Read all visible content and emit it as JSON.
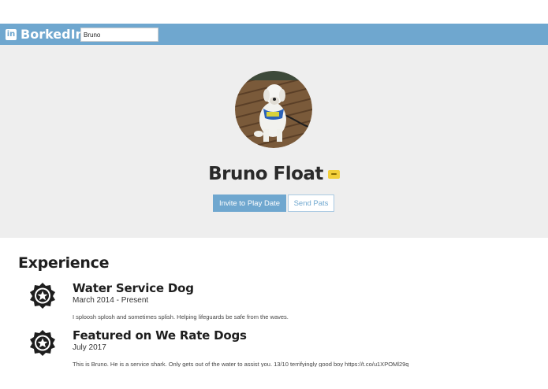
{
  "navbar": {
    "logo_glyph": "in",
    "logo_text": "BorkedIn",
    "search_value": "Bruno",
    "color": "#6fa7cf"
  },
  "profile": {
    "name": "Bruno Float",
    "badge_icon": "dog-badge-icon",
    "primary_button": "Invite to Play Date",
    "secondary_button": "Send Pats",
    "avatar_icon": "dog-photo"
  },
  "experience": {
    "title": "Experience",
    "items": [
      {
        "title": "Water Service Dog",
        "date": "March 2014 - Present",
        "description": "I sploosh splosh and sometimes splish. Helping lifeguards be safe from the waves.",
        "icon": "badge-star-icon"
      },
      {
        "title": "Featured on We Rate Dogs",
        "date": "July 2017",
        "description": "This is Bruno. He is a service shark. Only gets out of the water to assist you. 13/10 terrifyingly good boy https://t.co/u1XPOMl29q",
        "icon": "badge-star-icon"
      }
    ]
  }
}
